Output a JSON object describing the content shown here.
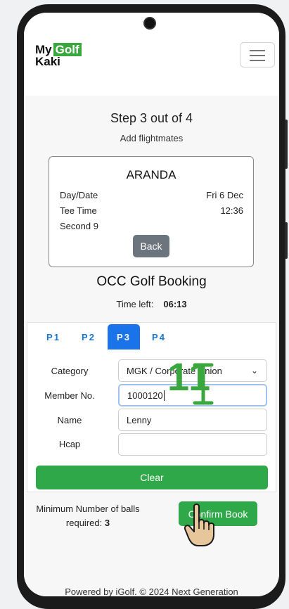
{
  "app": {
    "logo_my": "My",
    "logo_golf": "Golf",
    "logo_kaki": "Kaki"
  },
  "step": {
    "title": "Step 3 out of 4",
    "subtitle": "Add flightmates"
  },
  "booking_card": {
    "club": "ARANDA",
    "day_date_label": "Day/Date",
    "day_date_value": "Fri 6 Dec",
    "tee_time_label": "Tee Time",
    "tee_time_value": "12:36",
    "nine": "Second 9",
    "back_label": "Back"
  },
  "booking": {
    "title": "OCC Golf Booking",
    "time_left_label": "Time left:",
    "time_left_value": "06:13"
  },
  "tabs": [
    {
      "label": "P1",
      "active": false
    },
    {
      "label": "P2",
      "active": false
    },
    {
      "label": "P3",
      "active": true
    },
    {
      "label": "P4",
      "active": false
    }
  ],
  "form": {
    "category_label": "Category",
    "category_value": "MGK / Corporate Union",
    "member_label": "Member No.",
    "member_value": "1000120",
    "name_label": "Name",
    "name_value": "Lenny",
    "hcap_label": "Hcap",
    "hcap_value": "",
    "clear_label": "Clear"
  },
  "min_balls": {
    "label": "Minimum Number of balls required:",
    "value": "3"
  },
  "confirm_label": "Confirm Book",
  "footer": {
    "text": "Powered by iGolf. © 2024 Next Generation"
  },
  "overlay": {
    "number": "11"
  },
  "colors": {
    "accent_green": "#2fa84a",
    "tab_blue": "#1a73e8",
    "back_gray": "#6c757d"
  }
}
